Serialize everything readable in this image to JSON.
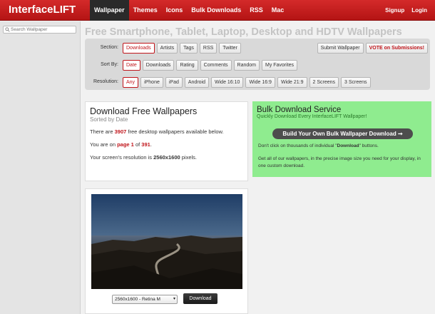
{
  "header": {
    "logo": "InterfaceLIFT",
    "nav": [
      "Wallpaper",
      "Themes",
      "Icons",
      "Bulk Downloads",
      "RSS",
      "Mac"
    ],
    "active_nav": "Wallpaper",
    "signup": "Signup",
    "login": "Login"
  },
  "sidebar": {
    "search_placeholder": "Search Wallpaper"
  },
  "page_title": "Free Smartphone, Tablet, Laptop, Desktop and HDTV Wallpapers",
  "filters": {
    "section": {
      "label": "Section:",
      "options": [
        "Downloads",
        "Artists",
        "Tags",
        "RSS",
        "Twitter"
      ],
      "selected": "Downloads",
      "right": [
        "Submit Wallpaper",
        "VOTE on Submissions!"
      ]
    },
    "sort": {
      "label": "Sort By:",
      "options": [
        "Date",
        "Downloads",
        "Rating",
        "Comments",
        "Random",
        "My Favorites"
      ],
      "selected": "Date"
    },
    "resolution": {
      "label": "Resolution:",
      "options": [
        "Any",
        "iPhone",
        "iPad",
        "Android",
        "Wide 16:10",
        "Wide 16:9",
        "Wide 21:9",
        "2 Screens",
        "3 Screens"
      ],
      "selected": "Any"
    }
  },
  "download": {
    "title": "Download Free Wallpapers",
    "subtitle": "Sorted by Date",
    "p1_pre": "There are ",
    "count": "3907",
    "p1_post": " free desktop wallpapers available below.",
    "p2_pre": "You are on ",
    "page_link": "page 1",
    "p2_mid": " of ",
    "total_pages": "391",
    "p2_post": ".",
    "p3_pre": "Your screen's resolution is ",
    "resolution": "2560x1600",
    "p3_post": " pixels."
  },
  "bulk": {
    "title": "Bulk Download Service",
    "subtitle": "Quickly Download Every InterfaceLIFT Wallpaper!",
    "button": "Build Your Own Bulk Wallpaper Download ➞",
    "p1_pre": "Don't click on thousands of individual \"",
    "p1_bold": "Download",
    "p1_post": "\" buttons.",
    "p2": "Get all of our wallpapers, in the precise image size you need for your display, in one custom download."
  },
  "wallpaper": {
    "resolution_option": "2560x1600 - Retina M",
    "download_label": "Download"
  },
  "colors": {
    "brand_red": "#c0141a",
    "bulk_green": "#8fec8f"
  }
}
